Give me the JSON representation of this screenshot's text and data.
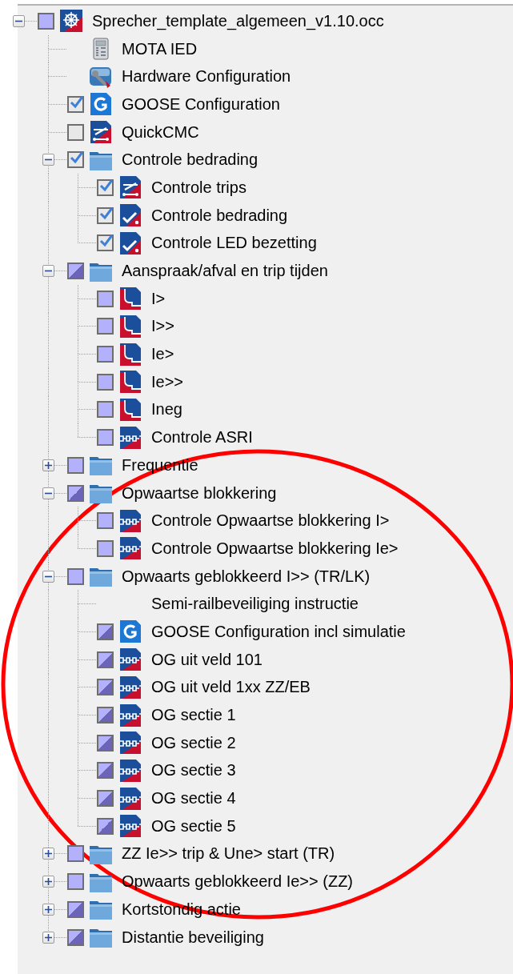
{
  "tree": {
    "label": "Sprecher_template_algemeen_v1.10.occ",
    "checked": false,
    "highlighted": true,
    "kind": "wheel",
    "expanded": true,
    "children": [
      {
        "label": "MOTA IED",
        "kind": "device"
      },
      {
        "label": "Hardware Configuration",
        "kind": "hardware"
      },
      {
        "label": "GOOSE Configuration",
        "checked": true,
        "highlighted": false,
        "kind": "goose"
      },
      {
        "label": "QuickCMC",
        "checked": false,
        "highlighted": false,
        "kind": "switch"
      },
      {
        "label": "Controle bedrading",
        "checked": true,
        "highlighted": false,
        "kind": "folder",
        "expanded": true,
        "children": [
          {
            "label": "Controle trips",
            "checked": true,
            "highlighted": false,
            "kind": "switch"
          },
          {
            "label": "Controle bedrading",
            "checked": true,
            "highlighted": false,
            "kind": "tick"
          },
          {
            "label": "Controle LED bezetting",
            "checked": true,
            "highlighted": false,
            "kind": "tick"
          }
        ]
      },
      {
        "label": "Aanspraak/afval en trip tijden",
        "checked": true,
        "partial": true,
        "highlighted": true,
        "kind": "folder",
        "expanded": true,
        "children": [
          {
            "label": "I>",
            "checked": false,
            "highlighted": true,
            "kind": "curve"
          },
          {
            "label": "I>>",
            "checked": false,
            "highlighted": true,
            "kind": "curve"
          },
          {
            "label": "Ie>",
            "checked": false,
            "highlighted": true,
            "kind": "curve"
          },
          {
            "label": "Ie>>",
            "checked": false,
            "highlighted": true,
            "kind": "curve"
          },
          {
            "label": "Ineg",
            "checked": false,
            "highlighted": true,
            "kind": "curve"
          },
          {
            "label": "Controle ASRI",
            "checked": false,
            "highlighted": true,
            "kind": "chain"
          }
        ]
      },
      {
        "label": "Frequentie",
        "checked": false,
        "highlighted": true,
        "kind": "folder",
        "expanded": false
      },
      {
        "label": "Opwaartse blokkering",
        "checked": true,
        "partial": true,
        "highlighted": true,
        "kind": "folder",
        "expanded": true,
        "children": [
          {
            "label": "Controle Opwaartse blokkering I>",
            "checked": false,
            "highlighted": true,
            "kind": "chain"
          },
          {
            "label": "Controle Opwaartse blokkering Ie>",
            "checked": false,
            "highlighted": true,
            "kind": "chain"
          }
        ]
      },
      {
        "label": "Opwaarts geblokkeerd I>> (TR/LK)",
        "checked": false,
        "highlighted": true,
        "kind": "folder",
        "expanded": true,
        "children": [
          {
            "label": "Semi-railbeveiliging instructie"
          },
          {
            "label": "GOOSE Configuration incl simulatie",
            "checked": true,
            "partial": true,
            "highlighted": true,
            "kind": "goose"
          },
          {
            "label": "OG uit veld 101",
            "checked": true,
            "partial": true,
            "highlighted": true,
            "kind": "chain"
          },
          {
            "label": "OG uit veld 1xx ZZ/EB",
            "checked": true,
            "partial": true,
            "highlighted": true,
            "kind": "chain"
          },
          {
            "label": "OG sectie 1",
            "checked": true,
            "partial": true,
            "highlighted": true,
            "kind": "chain"
          },
          {
            "label": "OG sectie 2",
            "checked": true,
            "partial": true,
            "highlighted": true,
            "kind": "chain"
          },
          {
            "label": "OG sectie 3",
            "checked": true,
            "partial": true,
            "highlighted": true,
            "kind": "chain"
          },
          {
            "label": "OG sectie 4",
            "checked": true,
            "partial": true,
            "highlighted": true,
            "kind": "chain"
          },
          {
            "label": "OG sectie 5",
            "checked": true,
            "partial": true,
            "highlighted": true,
            "kind": "chain"
          }
        ]
      },
      {
        "label": "ZZ Ie>> trip & Une> start (TR)",
        "checked": false,
        "highlighted": true,
        "kind": "folder",
        "expanded": false
      },
      {
        "label": "Opwaarts geblokkeerd Ie>> (ZZ)",
        "checked": false,
        "highlighted": true,
        "kind": "folder",
        "expanded": false
      },
      {
        "label": "Kortstondig actie",
        "checked": true,
        "partial": true,
        "highlighted": true,
        "kind": "folder",
        "expanded": false
      },
      {
        "label": "Distantie beveiliging",
        "checked": true,
        "partial": true,
        "highlighted": true,
        "kind": "folder",
        "expanded": false
      }
    ]
  },
  "annotation": {
    "kind": "ellipse"
  }
}
